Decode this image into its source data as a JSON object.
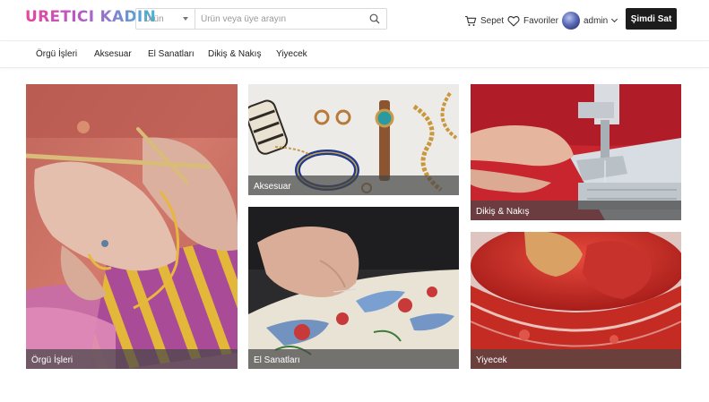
{
  "header": {
    "logo": "URETICI KADIN",
    "search": {
      "category": "Ürün",
      "placeholder": "Ürün veya üye arayın"
    },
    "cart_label": "Sepet",
    "favorites_label": "Favoriler",
    "user_name": "admin",
    "sell_button": "Şimdi Sat"
  },
  "categories": [
    "Örgü İşleri",
    "Aksesuar",
    "El Sanatları",
    "Dikiş & Nakış",
    "Yiyecek"
  ],
  "tiles": [
    {
      "label": "Örgü İşleri"
    },
    {
      "label": "Aksesuar"
    },
    {
      "label": "El Sanatları"
    },
    {
      "label": "Dikiş & Nakış"
    },
    {
      "label": "Yiyecek"
    }
  ],
  "colors": {
    "accent": "#1c1c1c",
    "logo_gradient": [
      "#e9459b",
      "#b45cc9",
      "#3fb7d6"
    ]
  }
}
